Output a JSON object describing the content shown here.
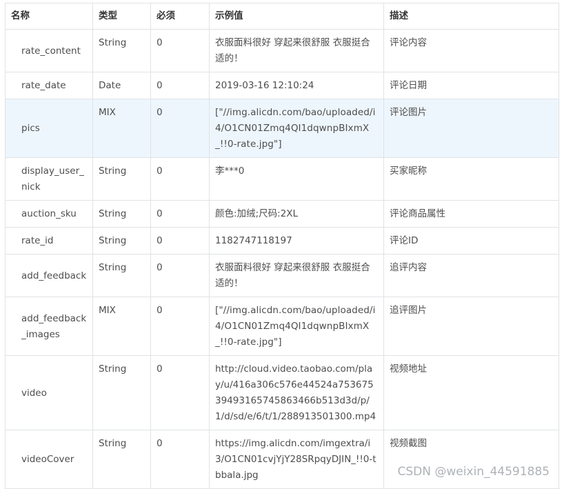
{
  "headers": [
    "名称",
    "类型",
    "必须",
    "示例值",
    "描述"
  ],
  "rows": [
    {
      "name": "rate_content",
      "type": "String",
      "required": "0",
      "example": "衣服面料很好 穿起来很舒服 衣服挺合适的！",
      "desc": "评论内容"
    },
    {
      "name": "rate_date",
      "type": "Date",
      "required": "0",
      "example": "2019-03-16 12:10:24",
      "desc": "评论日期"
    },
    {
      "name": "pics",
      "type": "MIX",
      "required": "0",
      "example": "[\"//img.alicdn.com/bao/uploaded/i4/O1CN01Zmq4QI1dqwnpBIxmX_!!0-rate.jpg\"]",
      "desc": "评论图片"
    },
    {
      "name": "display_user_nick",
      "type": "String",
      "required": "0",
      "example": "李***0",
      "desc": "买家昵称"
    },
    {
      "name": "auction_sku",
      "type": "String",
      "required": "0",
      "example": "颜色:加绒;尺码:2XL",
      "desc": "评论商品属性"
    },
    {
      "name": "rate_id",
      "type": "String",
      "required": "0",
      "example": "1182747118197",
      "desc": "评论ID"
    },
    {
      "name": "add_feedback",
      "type": "String",
      "required": "0",
      "example": "衣服面料很好 穿起来很舒服 衣服挺合适的！",
      "desc": "追评内容"
    },
    {
      "name": "add_feedback_images",
      "type": "MIX",
      "required": "0",
      "example": "[\"//img.alicdn.com/bao/uploaded/i4/O1CN01Zmq4QI1dqwnpBIxmX_!!0-rate.jpg\"]",
      "desc": "追评图片"
    },
    {
      "name": "video",
      "type": "String",
      "required": "0",
      "example": "http://cloud.video.taobao.com/play/u/416a306c576e44524a75367539493165745863466b513d3d/p/1/d/sd/e/6/t/1/288913501300.mp4",
      "desc": "视频地址"
    },
    {
      "name": "videoCover",
      "type": "String",
      "required": "0",
      "example": "https://img.alicdn.com/imgextra/i3/O1CN01cvjYjY28SRpqyDJIN_!!0-tbbala.jpg",
      "desc": "视频截图"
    }
  ],
  "watermark": "CSDN @weixin_44591885",
  "colors": {
    "border": "#dfe2e5",
    "highlight_row": "#eef6fd",
    "text": "#4d4d4d"
  }
}
